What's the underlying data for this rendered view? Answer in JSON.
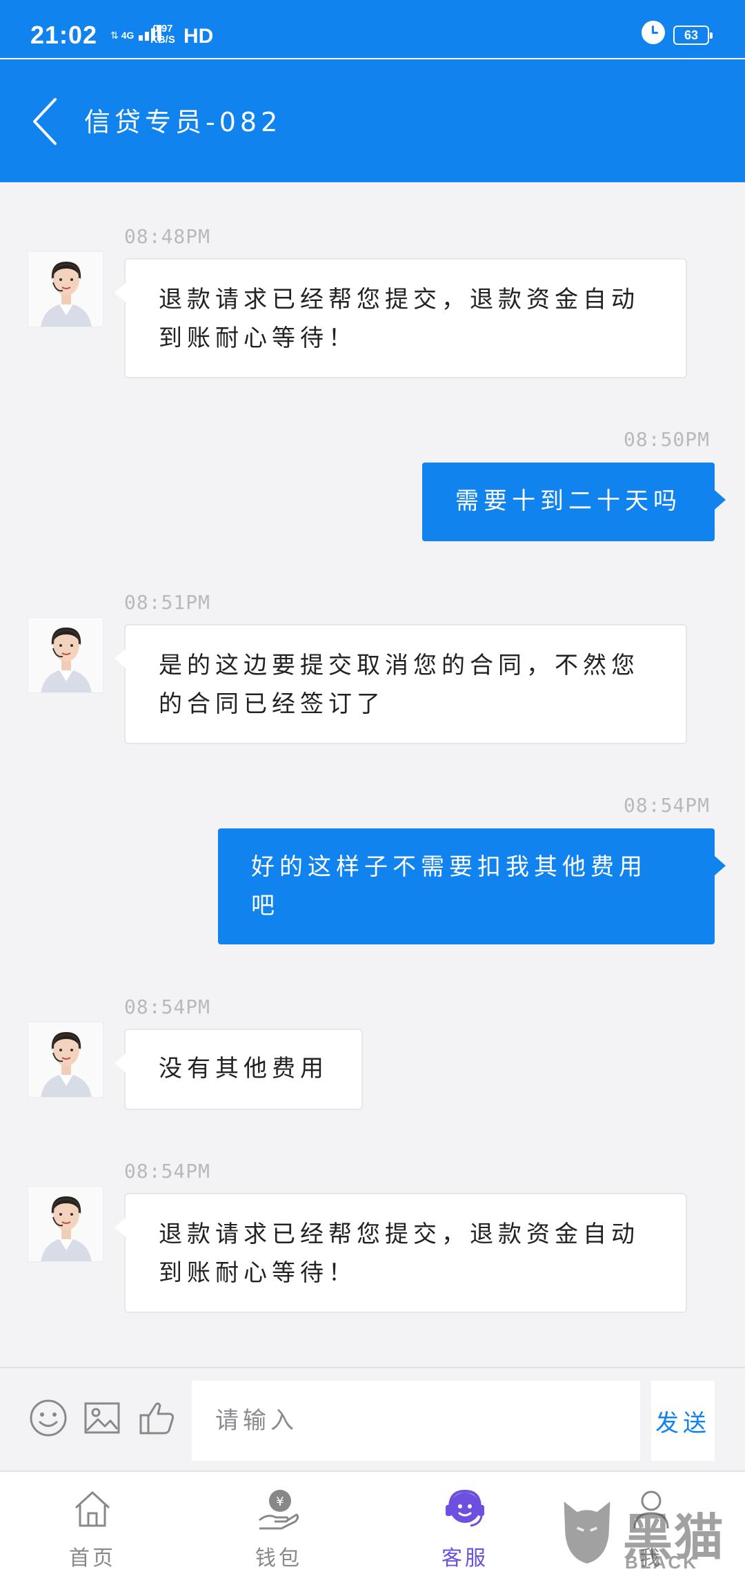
{
  "status_bar": {
    "time": "21:02",
    "network": "4G",
    "speed_value": "0.97",
    "speed_unit": "KB/S",
    "hd": "HD",
    "battery": "63"
  },
  "header": {
    "title": "信贷专员-082",
    "back_icon": "chevron-left-icon",
    "background": "#1083ee"
  },
  "messages": [
    {
      "side": "agent",
      "time": "08:48PM",
      "lines": [
        "退款请求已经帮您提交，退款资金自动",
        "到账耐心等待！"
      ]
    },
    {
      "side": "user",
      "time": "08:50PM",
      "lines": [
        "需要十到二十天吗"
      ]
    },
    {
      "side": "agent",
      "time": "08:51PM",
      "lines": [
        "是的这边要提交取消您的合同，不然您",
        "的合同已经签订了"
      ]
    },
    {
      "side": "user",
      "time": "08:54PM",
      "lines": [
        "好的这样子不需要扣我其他费用",
        "吧"
      ]
    },
    {
      "side": "agent",
      "time": "08:54PM",
      "lines": [
        "没有其他费用"
      ]
    },
    {
      "side": "agent",
      "time": "08:54PM",
      "lines": [
        "退款请求已经帮您提交，退款资金自动",
        "到账耐心等待！"
      ]
    }
  ],
  "input_bar": {
    "placeholder": "请输入",
    "send_label": "发送",
    "icons": [
      "emoji-icon",
      "image-icon",
      "thumbs-up-icon"
    ]
  },
  "bottom_nav": {
    "items": [
      {
        "label": "首页",
        "icon": "home-icon",
        "active": false
      },
      {
        "label": "钱包",
        "icon": "wallet-icon",
        "active": false
      },
      {
        "label": "客服",
        "icon": "customer-service-icon",
        "active": true
      },
      {
        "label": "我",
        "icon": "profile-icon",
        "active": false
      }
    ],
    "active_color": "#6f4fe0"
  },
  "watermark": {
    "text": "黑猫",
    "sub": "BLACK CAT"
  },
  "colors": {
    "accent": "#1083ee",
    "chat_bg": "#f3f3f6",
    "timestamp": "#b9b9bd"
  }
}
